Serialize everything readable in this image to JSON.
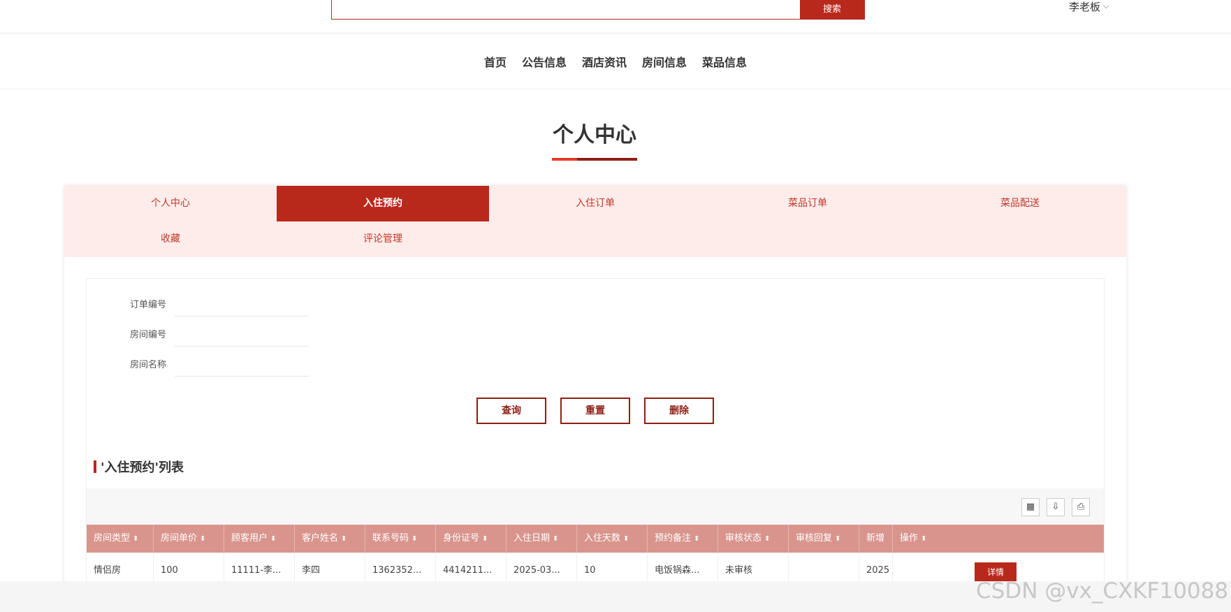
{
  "header": {
    "search_placeholder": "",
    "search_button": "搜索",
    "user_name": "李老板"
  },
  "nav": [
    "首页",
    "公告信息",
    "酒店资讯",
    "房间信息",
    "菜品信息"
  ],
  "page_title": "个人中心",
  "tabs": [
    {
      "label": "个人中心",
      "active": false
    },
    {
      "label": "入住预约",
      "active": true
    },
    {
      "label": "入住订单",
      "active": false
    },
    {
      "label": "菜品订单",
      "active": false
    },
    {
      "label": "菜品配送",
      "active": false
    },
    {
      "label": "收藏",
      "active": false
    },
    {
      "label": "评论管理",
      "active": false
    }
  ],
  "filters": {
    "order_no_label": "订单编号",
    "room_no_label": "房间编号",
    "room_name_label": "房间名称"
  },
  "actions": {
    "query": "查询",
    "reset": "重置",
    "delete": "删除"
  },
  "list_title": "'入住预约'列表",
  "table": {
    "columns": [
      "房间类型",
      "房间单价",
      "顾客用户",
      "客户姓名",
      "联系号码",
      "身份证号",
      "入住日期",
      "入住天数",
      "预约备注",
      "审核状态",
      "审核回复",
      "新增",
      "操作"
    ],
    "rows": [
      [
        "情侣房",
        "100",
        "11111-李...",
        "李四",
        "1362352...",
        "4414211...",
        "2025-03...",
        "10",
        "电饭锅森...",
        "未审核",
        "",
        "2025"
      ]
    ],
    "detail_label": "详情"
  },
  "watermark": "CSDN @vx_CXKF10088"
}
